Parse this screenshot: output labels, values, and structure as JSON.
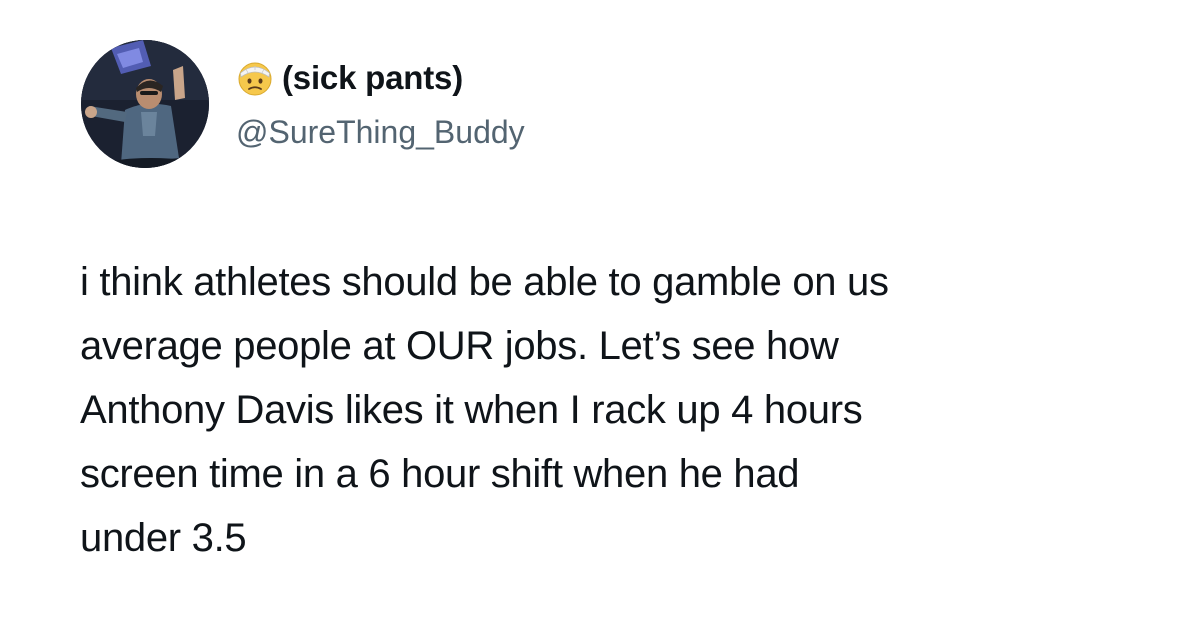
{
  "author": {
    "emoji_icon": "face-with-head-bandage-icon",
    "display_name": "(sick pants)",
    "handle": "@SureThing_Buddy"
  },
  "tweet": {
    "text": "i think athletes should be able to gamble on us\naverage people at OUR jobs. Let’s see how\nAnthony Davis likes it when I rack up 4 hours\nscreen time in a 6 hour shift when he had\nunder 3.5"
  },
  "colors": {
    "text_primary": "#0f1419",
    "text_secondary": "#536471",
    "background": "#ffffff"
  }
}
